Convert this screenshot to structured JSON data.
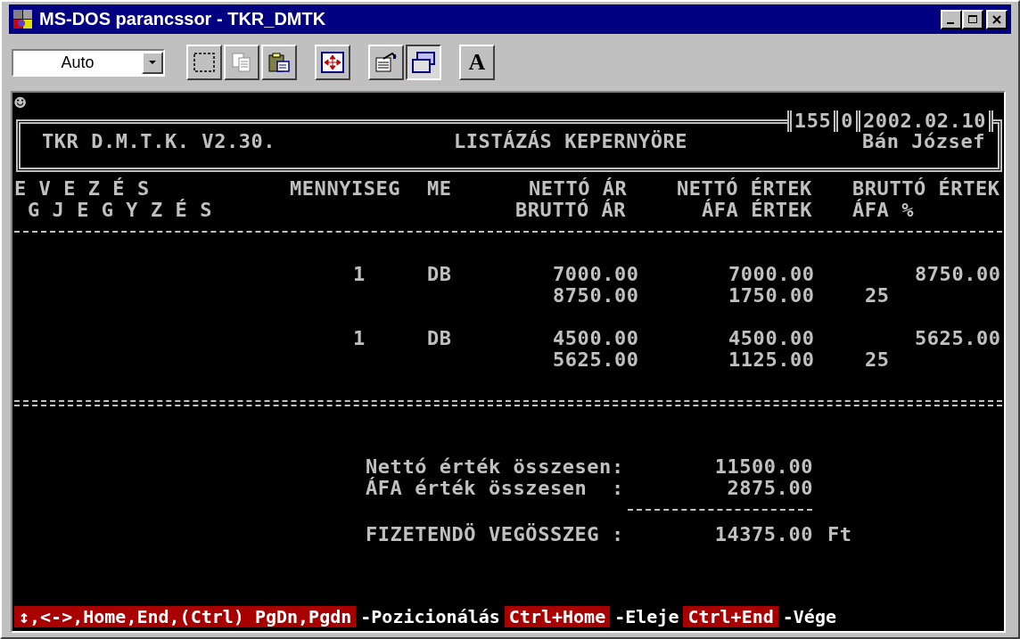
{
  "window": {
    "title": "MS-DOS parancssor - TKR_DMTK"
  },
  "toolbar": {
    "font_size": {
      "value": "Auto"
    },
    "buttons": [
      {
        "kind": "mark",
        "pressed": false
      },
      {
        "kind": "copy",
        "pressed": false
      },
      {
        "kind": "paste",
        "pressed": false
      },
      {
        "kind": "fullscreen",
        "pressed": false
      },
      {
        "kind": "properties",
        "pressed": false
      },
      {
        "kind": "background",
        "pressed": true
      },
      {
        "kind": "font",
        "label": "A",
        "pressed": false
      }
    ]
  },
  "terminal": {
    "indicator": "☻",
    "header": {
      "program": "TKR D.M.T.K. V2.30.",
      "screen_title": "LISTÁZÁS KEPERNYÖRE",
      "status_fields": [
        "155",
        "0",
        "2002.02.10"
      ],
      "user": "Bán József"
    },
    "column_headers": {
      "line_1": [
        "E V E Z É S",
        "MENNYISEG",
        "ME",
        "NETTÓ ÁR",
        "NETTÓ ÉRTEK",
        "BRUTTÓ ÉRTEK"
      ],
      "line_2": [
        "G J E G Y Z É S",
        "BRUTTÓ ÁR",
        "ÁFA ÉRTEK",
        "ÁFA %"
      ]
    },
    "items": [
      {
        "quantity": "1",
        "unit": "DB",
        "net_price": "7000.00",
        "net_value": "7000.00",
        "gross_value": "8750.00",
        "gross_price": "8750.00",
        "vat_value": "1750.00",
        "vat_percent": "25"
      },
      {
        "quantity": "1",
        "unit": "DB",
        "net_price": "4500.00",
        "net_value": "4500.00",
        "gross_value": "5625.00",
        "gross_price": "5625.00",
        "vat_value": "1125.00",
        "vat_percent": "25"
      }
    ],
    "totals": [
      {
        "label": "Nettó érték összesen:",
        "value": "11500.00"
      },
      {
        "label": "ÁFA érték összesen  :",
        "value": "2875.00"
      }
    ],
    "grand_total": {
      "label": "FIZETENDÖ VEGÖSSZEG :",
      "value": "14375.00",
      "currency": "Ft"
    },
    "key_help": [
      {
        "kind": "key",
        "text": "↕,<->,Home,End,(Ctrl) PgDn,Pgdn"
      },
      {
        "kind": "description",
        "text": "-Pozicionálás"
      },
      {
        "kind": "key",
        "text": "Ctrl+Home"
      },
      {
        "kind": "description",
        "text": "-Eleje"
      },
      {
        "kind": "key",
        "text": "Ctrl+End"
      },
      {
        "kind": "description",
        "text": "-Vége"
      }
    ]
  }
}
